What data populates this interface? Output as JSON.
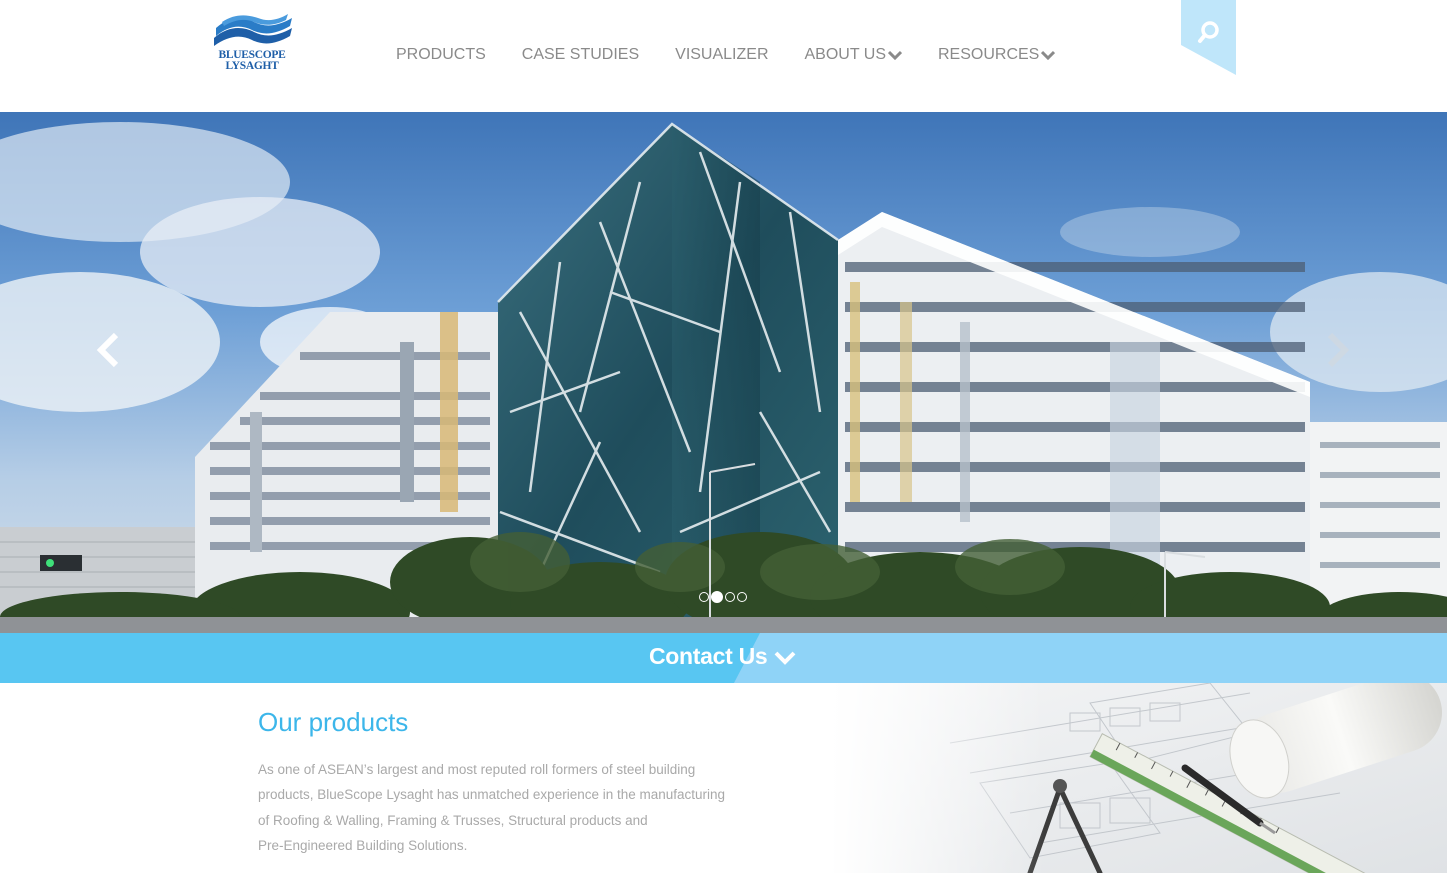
{
  "brand": {
    "logo_line1": "BLUESCOPE",
    "logo_line2": "LYSAGHT",
    "primary_color": "#1f5fa8",
    "accent_color": "#58c6f2"
  },
  "nav": {
    "items": [
      {
        "label": "PRODUCTS",
        "has_dropdown": false
      },
      {
        "label": "CASE STUDIES",
        "has_dropdown": false
      },
      {
        "label": "VISUALIZER",
        "has_dropdown": false
      },
      {
        "label": "ABOUT US",
        "has_dropdown": true
      },
      {
        "label": "RESOURCES",
        "has_dropdown": true
      }
    ],
    "search_icon": "search-icon"
  },
  "hero": {
    "prev_icon": "chevron-left-icon",
    "next_icon": "chevron-right-icon",
    "slides_count": 4,
    "active_slide": 2
  },
  "contact": {
    "label": "Contact Us",
    "icon": "chevron-down-icon"
  },
  "products": {
    "title": "Our products",
    "description_lines": [
      "As one of ASEAN’s largest and most reputed roll formers of steel building",
      "products, BlueScope Lysaght has unmatched experience in the manufacturing",
      "of Roofing & Walling, Framing & Trusses, Structural products and",
      "Pre-Engineered Building Solutions."
    ]
  }
}
